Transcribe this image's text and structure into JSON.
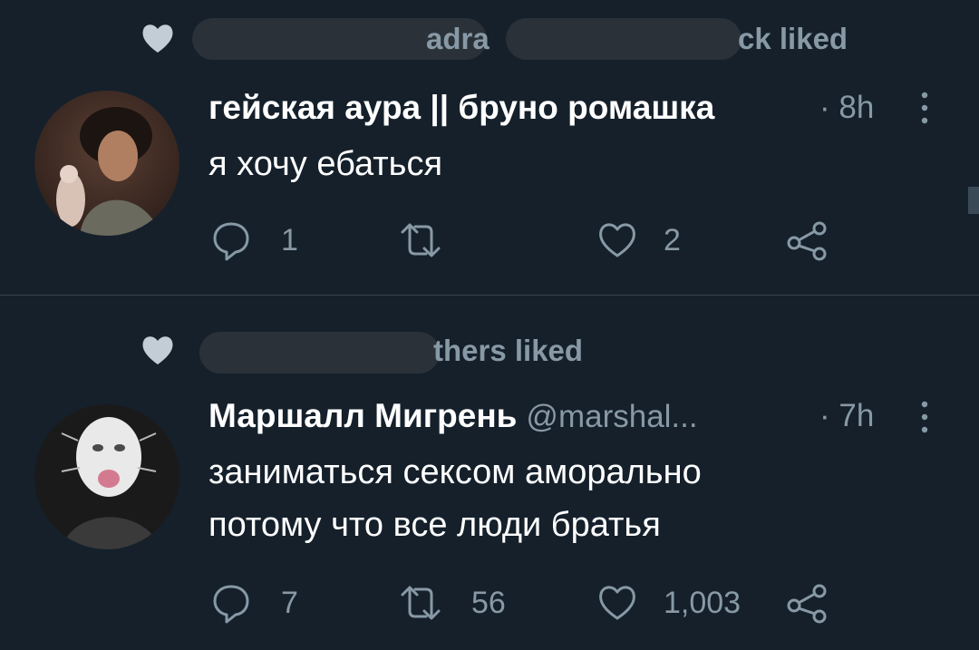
{
  "colors": {
    "background": "#15202b",
    "text_primary": "#ffffff",
    "text_secondary": "#8899a6",
    "divider": "#38444d",
    "redaction": "#2a3138"
  },
  "tweets": [
    {
      "social_context": {
        "icon": "heart-filled-icon",
        "text_fragment_1": "adra",
        "text_fragment_2": "ck liked"
      },
      "author_name": "гейская аура || бруно ромашка",
      "author_handle": "",
      "timestamp": "· 8h",
      "text": "я хочу ебаться",
      "actions": {
        "reply": {
          "icon": "reply-icon",
          "count": "1"
        },
        "retweet": {
          "icon": "retweet-icon",
          "count": ""
        },
        "like": {
          "icon": "heart-outline-icon",
          "count": "2"
        },
        "share": {
          "icon": "share-icon",
          "count": ""
        }
      }
    },
    {
      "social_context": {
        "icon": "heart-filled-icon",
        "text_fragment_1": "thers liked"
      },
      "author_name": "Маршалл Мигрень",
      "author_handle": "@marshal...",
      "timestamp": "· 7h",
      "text": "заниматься сексом аморально\nпотому что все люди братья",
      "actions": {
        "reply": {
          "icon": "reply-icon",
          "count": "7"
        },
        "retweet": {
          "icon": "retweet-icon",
          "count": "56"
        },
        "like": {
          "icon": "heart-outline-icon",
          "count": "1,003"
        },
        "share": {
          "icon": "share-icon",
          "count": ""
        }
      }
    }
  ]
}
